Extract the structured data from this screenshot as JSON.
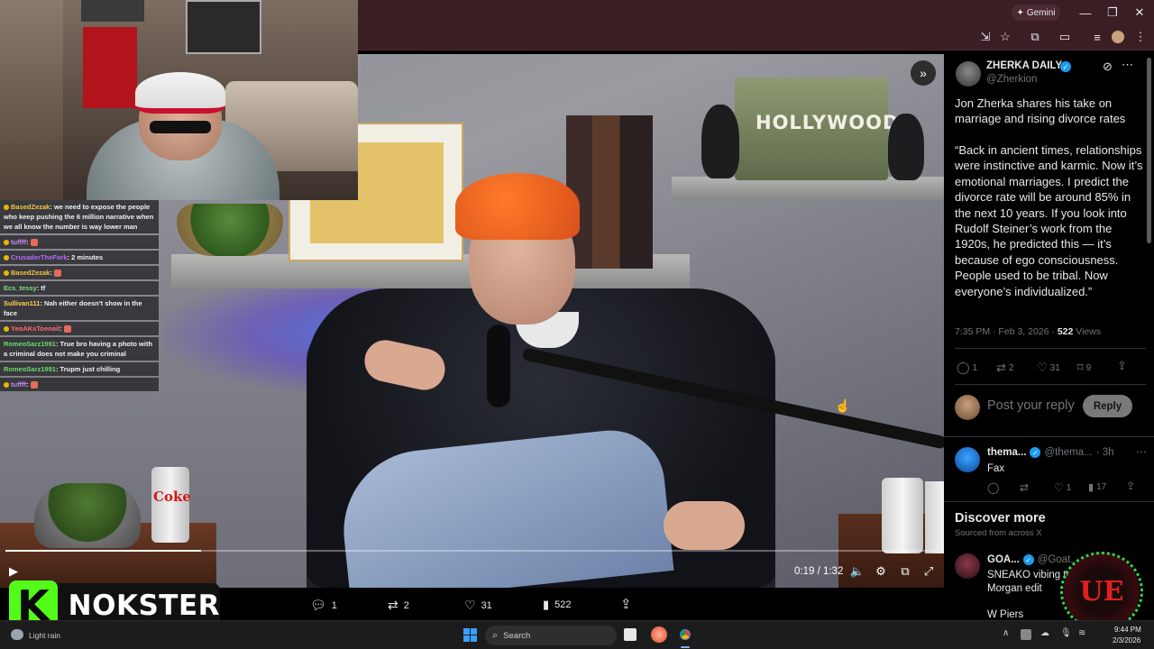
{
  "browser": {
    "gemini_label": "Gemini"
  },
  "chat": {
    "messages": [
      {
        "user": "BasedZezak",
        "text": " we need to expose the people who keep pushing the 6 million narrative when we all know the number is way lower man",
        "color": "#f5c542"
      },
      {
        "user": "tuffff",
        "text": "",
        "color": "#c48cff"
      },
      {
        "user": "CrusaderTheFork",
        "text": " 2 minutes",
        "color": "#b36bff"
      },
      {
        "user": "BasedZezak",
        "text": "",
        "color": "#f5c542"
      },
      {
        "user": "Ecs_tessy",
        "text": " tf",
        "color": "#7fe07f"
      },
      {
        "user": "Sullivan111",
        "text": " Nah either doesn't show in the face",
        "color": "#ffd34d"
      },
      {
        "user": "YeoAKsToenail",
        "text": "",
        "color": "#ff6b6b"
      },
      {
        "user": "RomeoSarz1991",
        "text": " True bro having a photo with a criminal does not make you criminal",
        "color": "#6bdc6b"
      },
      {
        "user": "RomeoSarz1991",
        "text": " Trupm just chilling",
        "color": "#6bdc6b"
      },
      {
        "user": "tuffff",
        "text": "",
        "color": "#c48cff"
      }
    ]
  },
  "video": {
    "time": "0:19 / 1:32",
    "progress": 0.21,
    "shelf_sign": "HOLLYWOOD",
    "can_label": "Coke"
  },
  "nokster": {
    "letter": "K",
    "name": "NOKSTER"
  },
  "actions": {
    "replies": "1",
    "reposts": "2",
    "likes": "31",
    "views": "522"
  },
  "post": {
    "author": "ZHERKA DAILY",
    "handle": "@Zherkion",
    "headline": "Jon Zherka shares his take on marriage and rising divorce rates",
    "quote": "“Back in ancient times, relationships were instinctive and karmic. Now it’s emotional marriages. I predict the divorce rate will be around 85% in the next 10 years. If you look into Rudolf Steiner’s work from the 1920s, he predicted this — it’s because of ego consciousness. People used to be tribal. Now everyone’s individualized.”",
    "timestamp": "7:35 PM · Feb 3, 2026 · ",
    "views_count": "522",
    "views_label": " Views",
    "stats": {
      "replies": "1",
      "reposts": "2",
      "likes": "31",
      "bookmarks": "9"
    },
    "reply_placeholder": "Post your reply",
    "reply_button": "Reply"
  },
  "reply1": {
    "name": "thema...",
    "handle": "@thema...",
    "time": "· 3h",
    "text": "Fax",
    "stats": {
      "reposts": "",
      "likes": "1",
      "views": "17"
    }
  },
  "discover": {
    "title": "Discover more",
    "subtitle": "Sourced from across X",
    "name": "GOA...",
    "handle": "@Goat...",
    "line1": "SNEAKO vibing to a",
    "line2": "Morgan edit",
    "line3": "W Piers"
  },
  "taskbar": {
    "weather": "Light rain",
    "search_placeholder": "Search",
    "time": "9:44 PM",
    "date": "2/3/2026",
    "watermark": "UE"
  }
}
